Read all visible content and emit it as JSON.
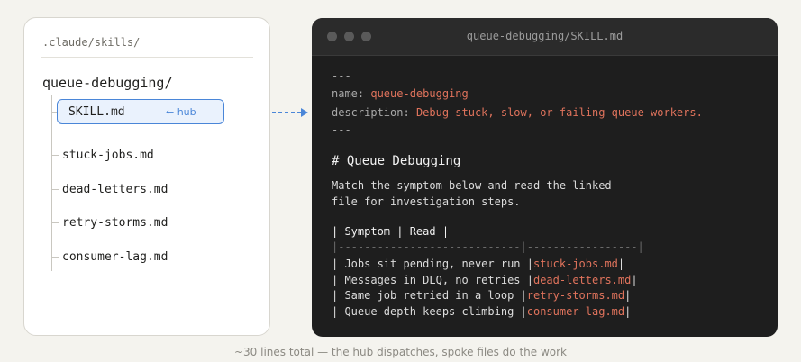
{
  "tree": {
    "path": ".claude/skills/",
    "root": "queue-debugging/",
    "hub_file": "SKILL.md",
    "hub_tag": "← hub",
    "files": [
      "stuck-jobs.md",
      "dead-letters.md",
      "retry-storms.md",
      "consumer-lag.md"
    ]
  },
  "code": {
    "window_title": "queue-debugging/SKILL.md",
    "frontmatter_open": "---",
    "name_key": "name:",
    "name_value": "queue-debugging",
    "desc_key": "description:",
    "desc_value": "Debug stuck, slow, or failing queue workers.",
    "frontmatter_close": "---",
    "heading": "# Queue Debugging",
    "body_line1": "Match the symptom below and read the linked",
    "body_line2": "file for investigation steps.",
    "table_header": "| Symptom | Read |",
    "table_separator": "|----------------------------|-----------------|",
    "rows": [
      {
        "symptom": "| Jobs sit pending, never run |",
        "link": "stuck-jobs.md",
        "end": "|"
      },
      {
        "symptom": "| Messages in DLQ, no retries |",
        "link": "dead-letters.md",
        "end": "|"
      },
      {
        "symptom": "| Same job retried in a loop |",
        "link": "retry-storms.md",
        "end": "|"
      },
      {
        "symptom": "| Queue depth keeps climbing |",
        "link": "consumer-lag.md",
        "end": "|"
      }
    ]
  },
  "caption": "~30 lines total — the hub dispatches, spoke files do the work",
  "colors": {
    "accent_blue": "#4a86d8",
    "code_value": "#e0735c",
    "code_bg": "#1e1e1e"
  }
}
